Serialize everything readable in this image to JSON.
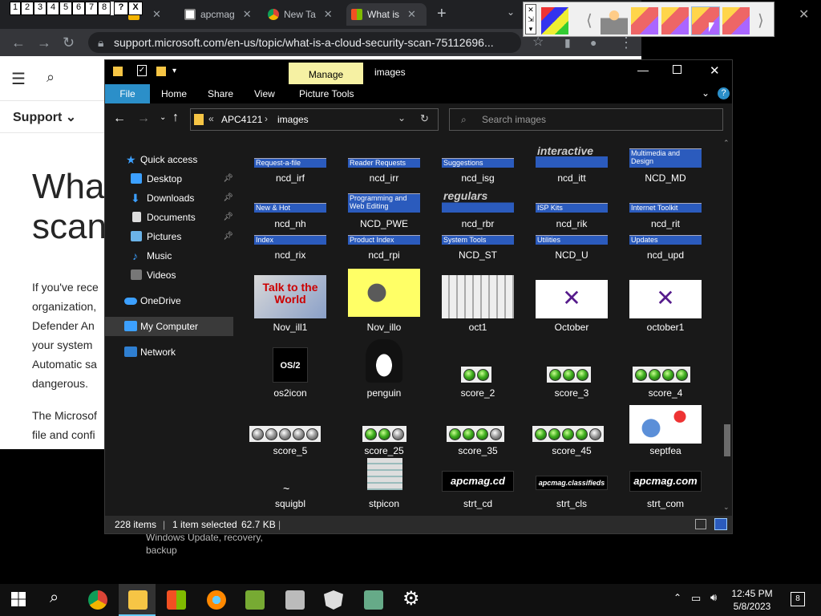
{
  "browser": {
    "tabs": [
      {
        "label": "",
        "active": false
      },
      {
        "label": "",
        "active": false
      },
      {
        "label": "apcmag",
        "active": false
      },
      {
        "label": "New Ta",
        "active": false
      },
      {
        "label": "What is",
        "active": true
      }
    ],
    "new_tab": "+",
    "url": "support.microsoft.com/en-us/topic/what-is-a-cloud-security-scan-75112696...",
    "page": {
      "support_label": "Support",
      "heading_line1": "What",
      "heading_line2": "scan",
      "paragraph1": [
        "If you've rece",
        "organization,",
        "Defender An",
        "your system",
        "Automatic sa",
        "dangerous."
      ],
      "paragraph2": [
        "The Microsof",
        "file and confi"
      ],
      "bottom_text": [
        "Windows Update, recovery,",
        "backup"
      ]
    }
  },
  "keybar": {
    "keys": [
      "1",
      "2",
      "3",
      "4",
      "5",
      "6",
      "7",
      "8",
      "?",
      "X"
    ]
  },
  "explorer": {
    "title": "images",
    "manage_tab": "Manage",
    "ribbon_tabs": [
      "File",
      "Home",
      "Share",
      "View",
      "Picture Tools"
    ],
    "address": {
      "prefix": "«",
      "crumbs": [
        "APC4121",
        "images"
      ],
      "separator": "›"
    },
    "search_placeholder": "Search images",
    "nav": [
      {
        "label": "Quick access",
        "pinned": false
      },
      {
        "label": "Desktop",
        "pinned": true
      },
      {
        "label": "Downloads",
        "pinned": true
      },
      {
        "label": "Documents",
        "pinned": true
      },
      {
        "label": "Pictures",
        "pinned": true
      },
      {
        "label": "Music",
        "pinned": false
      },
      {
        "label": "Videos",
        "pinned": false
      },
      {
        "label": "OneDrive",
        "pinned": false
      },
      {
        "label": "My Computer",
        "pinned": false,
        "selected": true
      },
      {
        "label": "Network",
        "pinned": false
      }
    ],
    "files": {
      "row1": [
        {
          "name": "ncd_irf",
          "banner": "Request-a-file"
        },
        {
          "name": "ncd_irr",
          "banner": "Reader Requests"
        },
        {
          "name": "ncd_isg",
          "banner": "Suggestions"
        },
        {
          "name": "ncd_itt",
          "banner": "interactive"
        },
        {
          "name": "NCD_MD",
          "banner": "Multimedia and Design"
        }
      ],
      "row2": [
        {
          "name": "ncd_nh",
          "banner": "New & Hot"
        },
        {
          "name": "NCD_PWE",
          "banner": "Programming and Web Editing"
        },
        {
          "name": "ncd_rbr",
          "banner": "regulars"
        },
        {
          "name": "ncd_rik",
          "banner": "ISP Kits"
        },
        {
          "name": "ncd_rit",
          "banner": "Internet Toolkit"
        }
      ],
      "row3": [
        {
          "name": "ncd_rix",
          "banner": "Index"
        },
        {
          "name": "ncd_rpi",
          "banner": "Product Index"
        },
        {
          "name": "NCD_ST",
          "banner": "System Tools"
        },
        {
          "name": "NCD_U",
          "banner": "Utilities"
        },
        {
          "name": "ncd_upd",
          "banner": "Updates"
        }
      ],
      "row4": [
        "Nov_ill1",
        "Nov_illo",
        "oct1",
        "October",
        "october1"
      ],
      "row5": [
        "os2icon",
        "penguin",
        "score_2",
        "score_3",
        "score_4"
      ],
      "row6": [
        "score_5",
        "score_25",
        "score_35",
        "score_45",
        "septfea"
      ],
      "row7": [
        "squigbl",
        "stpicon",
        "strt_cd",
        "strt_cls",
        "strt_com"
      ],
      "pic_text": {
        "talk": "Talk to the World",
        "os2": "OS/2",
        "apc_cd": "apcmag.cd",
        "apc_cls": "apcmag.classifieds",
        "apc_com": "apcmag.com"
      },
      "scores": {
        "score_2": 2,
        "score_3": 3,
        "score_4": 4,
        "score_5": 5,
        "score_25": 3,
        "score_35": 4,
        "score_45": 5
      }
    },
    "status": {
      "count": "228 items",
      "selection": "1 item selected",
      "size": "62.7 KB"
    }
  },
  "taskbar": {
    "time": "12:45 PM",
    "date": "5/8/2023",
    "notifications": "8"
  },
  "colors": {
    "explorer_bg": "#191919",
    "manage_tab": "#f6f1a3",
    "file_tab": "#2b8fc9",
    "banner_blue": "#2b5bbd"
  }
}
